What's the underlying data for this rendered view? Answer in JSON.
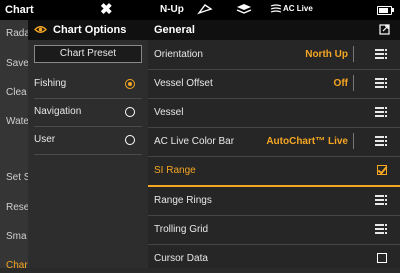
{
  "topbar": {
    "title": "Chart",
    "x_icon": "✖",
    "nup_label": "N-Up",
    "ac_live": "AC Live"
  },
  "background_menu": {
    "items": [
      "Rada",
      "Save",
      "Clea",
      "Wate",
      "Set S",
      "Rese",
      "Sma",
      "Char"
    ]
  },
  "chart_options": {
    "title": "Chart Options",
    "preset_label": "Chart Preset",
    "presets": [
      {
        "label": "Fishing",
        "selected": true
      },
      {
        "label": "Navigation",
        "selected": false
      },
      {
        "label": "User",
        "selected": false
      }
    ]
  },
  "general": {
    "title": "General",
    "rows": [
      {
        "label": "Orientation",
        "value": "North Up",
        "control": "menu"
      },
      {
        "label": "Vessel Offset",
        "value": "Off",
        "control": "menu"
      },
      {
        "label": "Vessel",
        "value": "",
        "control": "menu"
      },
      {
        "label": "AC Live Color Bar",
        "value": "AutoChart™ Live",
        "control": "menu"
      },
      {
        "label": "SI Range",
        "value": "",
        "control": "checkbox",
        "checked": true,
        "selected": true
      },
      {
        "label": "Range Rings",
        "value": "",
        "control": "menu"
      },
      {
        "label": "Trolling Grid",
        "value": "",
        "control": "menu"
      },
      {
        "label": "Cursor Data",
        "value": "",
        "control": "checkbox",
        "checked": false
      }
    ]
  },
  "colors": {
    "accent": "#f5a623",
    "header_bg": "#101010",
    "panel_bg": "#262626"
  }
}
